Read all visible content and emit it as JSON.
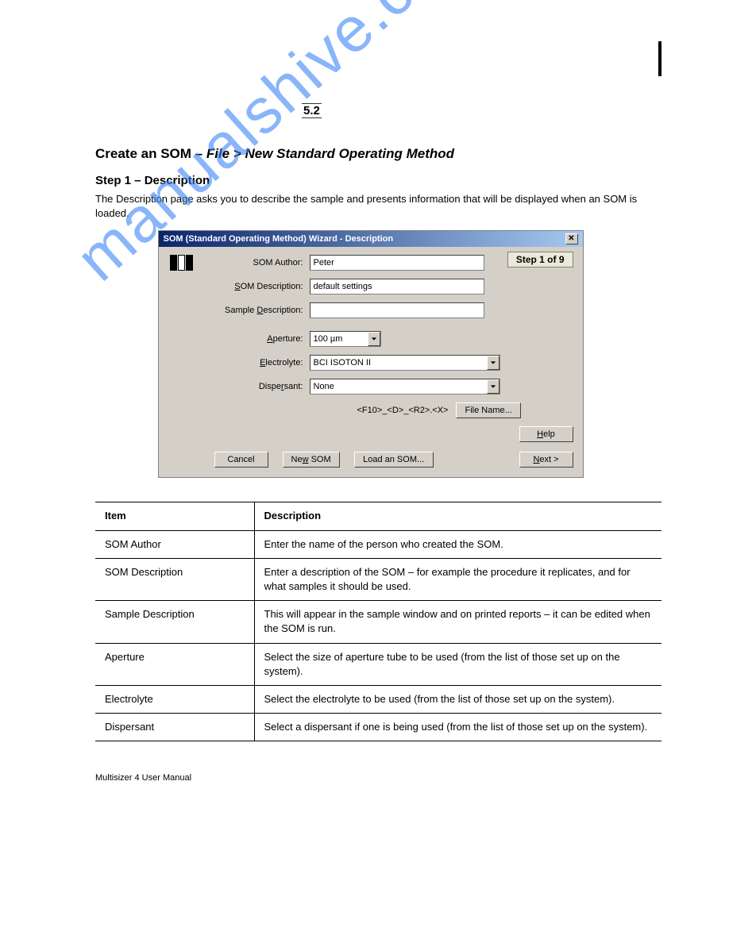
{
  "watermark": "manualshive.com",
  "section_number": "5.2",
  "section_title_lead": "Create an SOM –",
  "section_title_path": "File > New Standard Operating Method",
  "subsection_title": "Step 1 – Description",
  "intro_text": "The Description page asks you to describe the sample and presents information that will be displayed when an SOM is loaded.",
  "dialog": {
    "title": "SOM (Standard Operating Method) Wizard - Description",
    "step_badge": "Step 1 of 9",
    "fields": {
      "author_label": "SOM Author:",
      "author_value": "Peter",
      "desc_label_pre": "S",
      "desc_label_post": "OM Description:",
      "desc_value": "default settings",
      "sample_label_pre": "Sample ",
      "sample_label_u": "D",
      "sample_label_post": "escription:",
      "sample_value": "",
      "aperture_label_pre": "A",
      "aperture_label_post": "perture:",
      "aperture_value": "100 µm",
      "electrolyte_label_pre": "E",
      "electrolyte_label_post": "lectrolyte:",
      "electrolyte_value": "BCI ISOTON II",
      "dispersant_label_pre": "Dispe",
      "dispersant_label_u": "r",
      "dispersant_label_post": "sant:",
      "dispersant_value": "None",
      "filename_pattern": "<F10>_<D>_<R2>.<X>",
      "file_name_btn": "File Name...",
      "help_btn_u": "H",
      "help_btn_post": "elp",
      "cancel_btn": "Cancel",
      "new_som_btn_pre": "Ne",
      "new_som_btn_u": "w",
      "new_som_btn_post": " SOM",
      "load_som_btn": "Load an SOM...",
      "next_btn_u": "N",
      "next_btn_post": "ext >"
    }
  },
  "table": {
    "header_item": "Item",
    "header_desc": "Description",
    "rows": [
      {
        "item": "SOM Author",
        "desc": "Enter the name of the person who created the SOM."
      },
      {
        "item": "SOM Description",
        "desc": "Enter a description of the SOM – for example the procedure it replicates, and for what samples it should be used."
      },
      {
        "item": "Sample Description",
        "desc": "This will appear in the sample window and on printed reports – it can be edited when the SOM is run."
      },
      {
        "item": "Aperture",
        "desc": "Select the size of aperture tube to be used (from the list of those set up on the system)."
      },
      {
        "item": "Electrolyte",
        "desc": "Select the electrolyte to be used (from the list of those set up on the system)."
      },
      {
        "item": "Dispersant",
        "desc": "Select a dispersant if one is being used (from the list of those set up on the system)."
      }
    ]
  },
  "footer": "Multisizer 4 User Manual"
}
